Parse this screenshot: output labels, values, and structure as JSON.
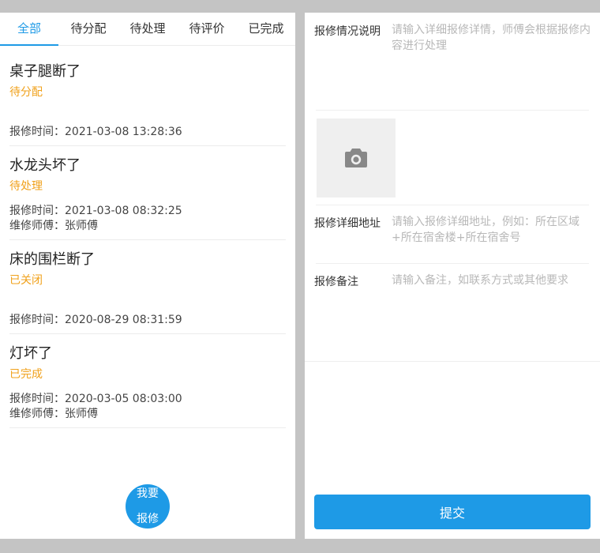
{
  "tabs": [
    {
      "label": "全部",
      "active": true
    },
    {
      "label": "待分配",
      "active": false
    },
    {
      "label": "待处理",
      "active": false
    },
    {
      "label": "待评价",
      "active": false
    },
    {
      "label": "已完成",
      "active": false
    }
  ],
  "orders": [
    {
      "title": "桌子腿断了",
      "status": "待分配",
      "time_label": "报修时间：",
      "time": "2021-03-08 13:28:36"
    },
    {
      "title": "水龙头坏了",
      "status": "待处理",
      "time_label": "报修时间：",
      "time": "2021-03-08 08:32:25",
      "worker_label": "维修师傅：",
      "worker": "张师傅"
    },
    {
      "title": "床的围栏断了",
      "status": "已关闭",
      "time_label": "报修时间：",
      "time": "2020-08-29 08:31:59"
    },
    {
      "title": "灯坏了",
      "status": "已完成",
      "time_label": "报修时间：",
      "time": "2020-03-05 08:03:00",
      "worker_label": "维修师傅：",
      "worker": "张师傅"
    }
  ],
  "fab": {
    "line1": "我要",
    "line2": "报修"
  },
  "form": {
    "description": {
      "label": "报修情况说明",
      "placeholder": "请输入详细报修详情，师傅会根据报修内容进行处理"
    },
    "photo": {
      "icon": "camera-icon"
    },
    "address": {
      "label": "报修详细地址",
      "placeholder": "请输入报修详细地址，例如：所在区域+所在宿舍楼+所在宿舍号"
    },
    "remark": {
      "label": "报修备注",
      "placeholder": "请输入备注，如联系方式或其他要求"
    },
    "submit_label": "提交"
  },
  "colors": {
    "accent": "#1e9ae6",
    "status": "#f0a11b",
    "background": "#c4c4c4"
  }
}
